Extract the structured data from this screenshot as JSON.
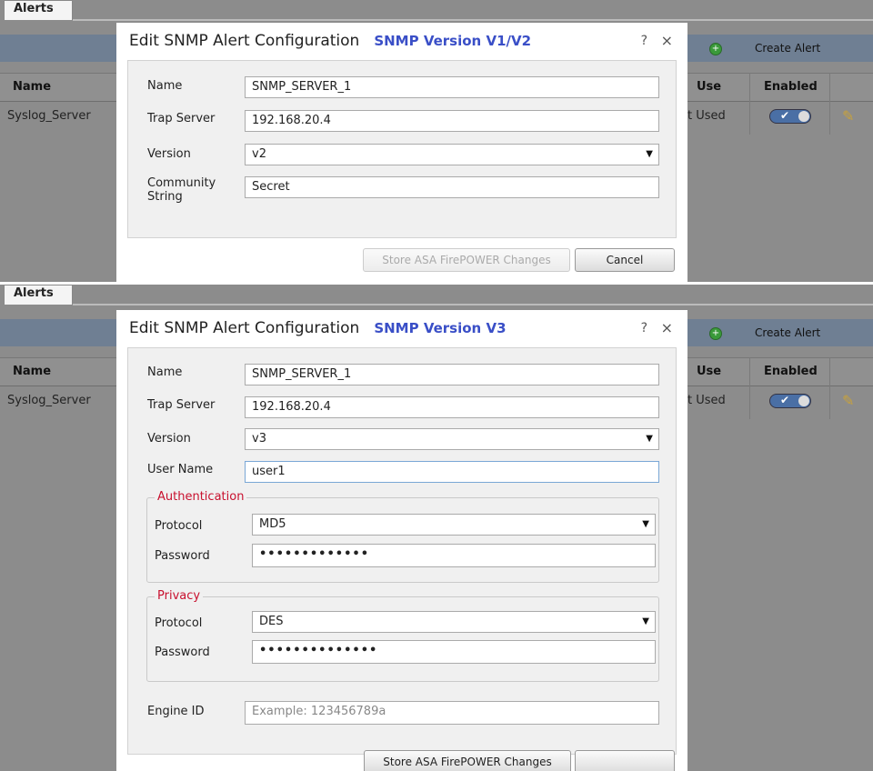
{
  "panel1": {
    "tab": "Alerts",
    "toolbar": {
      "create_label": "Create Alert"
    },
    "columns": {
      "name": "Name",
      "use": "Use",
      "enabled": "Enabled"
    },
    "row": {
      "name": "Syslog_Server",
      "use": "t Used"
    },
    "dialog": {
      "title": "Edit SNMP Alert Configuration",
      "version_note": "SNMP Version V1/V2",
      "help": "?",
      "close": "×",
      "fields": {
        "name_label": "Name",
        "name_value": "SNMP_SERVER_1",
        "trap_label": "Trap Server",
        "trap_value": "192.168.20.4",
        "version_label": "Version",
        "version_value": "v2",
        "community_label": "Community\nString",
        "community_value": "Secret"
      },
      "store_label": "Store ASA FirePOWER Changes",
      "cancel_label": "Cancel"
    }
  },
  "panel2": {
    "tab": "Alerts",
    "toolbar": {
      "create_label": "Create Alert"
    },
    "columns": {
      "name": "Name",
      "use": "Use",
      "enabled": "Enabled"
    },
    "row": {
      "name": "Syslog_Server",
      "use": "t Used"
    },
    "dialog": {
      "title": "Edit SNMP Alert Configuration",
      "version_note": "SNMP Version V3",
      "help": "?",
      "close": "×",
      "fields": {
        "name_label": "Name",
        "name_value": "SNMP_SERVER_1",
        "trap_label": "Trap Server",
        "trap_value": "192.168.20.4",
        "version_label": "Version",
        "version_value": "v3",
        "user_label": "User Name",
        "user_value": "user1"
      },
      "authentication": {
        "legend": "Authentication",
        "protocol_label": "Protocol",
        "protocol_value": "MD5",
        "password_label": "Password",
        "password_value": "•••••••••••••"
      },
      "privacy": {
        "legend": "Privacy",
        "protocol_label": "Protocol",
        "protocol_value": "DES",
        "password_label": "Password",
        "password_value": "••••••••••••••"
      },
      "engine": {
        "label": "Engine ID",
        "placeholder": "Example: 123456789a"
      },
      "store_label": "Store ASA FirePOWER Changes",
      "cancel_label": ""
    }
  }
}
